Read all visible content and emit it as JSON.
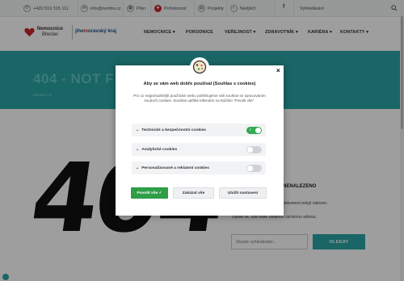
{
  "topbar": {
    "phone": "+420 519 315 111",
    "email": "info@nembv.cz",
    "items": [
      "Plán",
      "Pohotovost",
      "Projekty",
      "Nedýkčí"
    ],
    "search_placeholder": "Vyhledávání",
    "facebook": "f"
  },
  "header": {
    "logo_line1": "Nemocnice",
    "logo_line2": "Břeclav",
    "region_pre": "jiho",
    "region_mid": "m",
    "region_post": "oravský kraj",
    "nav": [
      "NEMOCNICE ▾",
      "PORODNICE",
      "VEŘEJNOST ▾",
      "ZDRAVOTNÍK ▾",
      "KARIÉRA ▾",
      "KONTAKTY ▾"
    ]
  },
  "hero": {
    "title": "404 - NOT F",
    "breadcrumb": "NEMBV.CZ"
  },
  "content": {
    "big_number": "404",
    "nf_title": "NENALEZENO",
    "nf_p1": "dokument nebyl nalezen.",
    "nf_p2": "Upište se, zda máte zadanou správnou adresu.",
    "search_placeholder": "Zkuste vyhledávání...",
    "search_button": "HLEDAT"
  },
  "cookie_modal": {
    "close": "×",
    "title": "Aby se vám web dobře používal (Souhlas s cookies)",
    "description": "Pro co nejpohodlnější používání webu potřebujeme váš souhlas se zpracováním souborů cookies. Souhlas udělíte kliknutím na tlačítko \"Povolit vše\".",
    "categories": [
      {
        "label": "Technické a bezpečnostní cookies",
        "enabled": true
      },
      {
        "label": "Analytické cookies",
        "enabled": false
      },
      {
        "label": "Personalizované a reklamní cookies",
        "enabled": false
      }
    ],
    "allow_all": "Povolit vše ✓",
    "reject_all": "Zakázat vše",
    "save_settings": "Uložit nastavení"
  },
  "colors": {
    "teal": "#2aa3a4",
    "green": "#2e9e47",
    "red": "#c9252b"
  }
}
